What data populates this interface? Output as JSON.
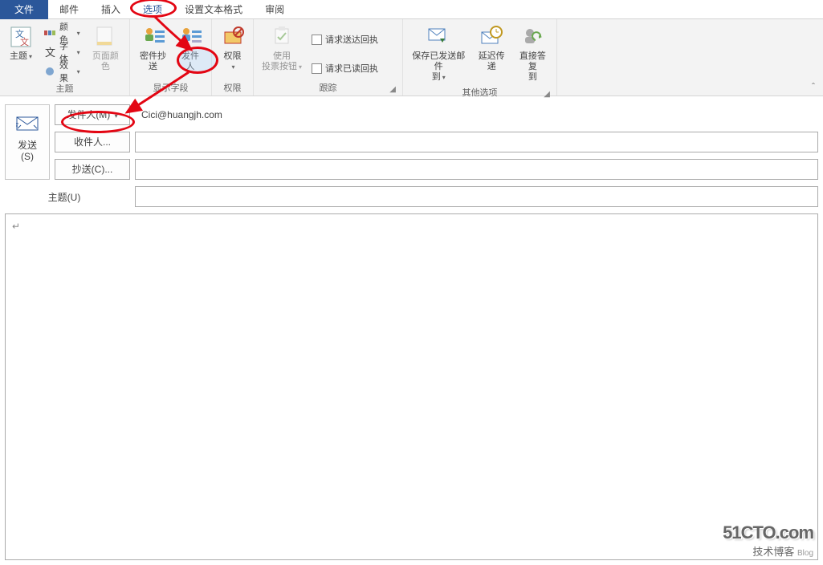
{
  "tabs": {
    "file": "文件",
    "mail": "邮件",
    "insert": "插入",
    "options": "选项",
    "format": "设置文本格式",
    "review": "审阅"
  },
  "ribbon": {
    "themes": {
      "colors": "颜色",
      "fonts": "字体",
      "effects": "效果",
      "theme_btn": "主题",
      "page_color": "页面颜色",
      "group_label": "主题"
    },
    "show_fields": {
      "bcc": "密件抄送",
      "from": "发件人",
      "group_label": "显示字段"
    },
    "permission": {
      "btn": "权限",
      "group_label": "权限"
    },
    "tracking": {
      "voting": "使用\n投票按钮",
      "delivery_receipt": "请求送达回执",
      "read_receipt": "请求已读回执",
      "group_label": "跟踪"
    },
    "more": {
      "save_sent": "保存已发送邮件\n到",
      "delay": "延迟传递",
      "reply_to": "直接答复\n到",
      "group_label": "其他选项"
    }
  },
  "compose": {
    "send": "发送\n(S)",
    "from_btn": "发件人(M)",
    "from_value": "Cici@huangjh.com",
    "to_btn": "收件人...",
    "cc_btn": "抄送(C)...",
    "subject_label": "主题(U)",
    "body_placeholder": "↵"
  },
  "watermark": {
    "top": "51CTO.com",
    "bottom": "技术博客",
    "blog": "Blog"
  }
}
